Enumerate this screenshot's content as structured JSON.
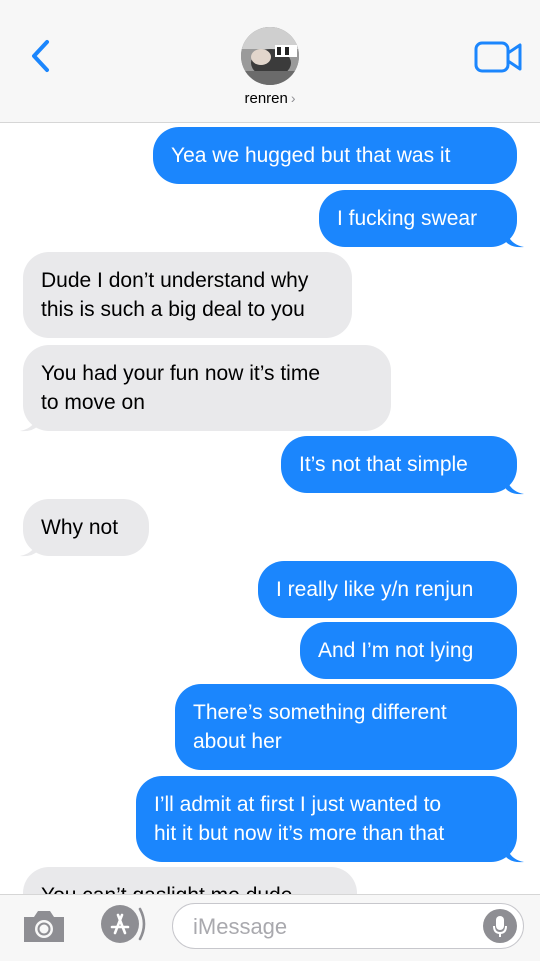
{
  "header": {
    "contact_name": "renren",
    "chevron": "›",
    "back_icon": "chevron-left-icon",
    "video_icon": "video-camera-icon",
    "accent_color": "#1b86fd"
  },
  "messages": [
    {
      "from": "me",
      "text": "Yea we hugged but that was it"
    },
    {
      "from": "me",
      "text": "I fucking swear"
    },
    {
      "from": "them",
      "text": "Dude I don’t understand why\nthis is such a big deal to you"
    },
    {
      "from": "them",
      "text": "You had your fun now it’s time\nto move on"
    },
    {
      "from": "me",
      "text": "It’s not that simple"
    },
    {
      "from": "them",
      "text": "Why not"
    },
    {
      "from": "me",
      "text": "I really like y/n renjun"
    },
    {
      "from": "me",
      "text": "And I’m not lying"
    },
    {
      "from": "me",
      "text": "There’s something different\nabout her"
    },
    {
      "from": "me",
      "text": "I’ll admit at first I just wanted to\nhit it but now it’s more than that"
    },
    {
      "from": "them",
      "text": "You can’t gaslight me dude"
    }
  ],
  "composer": {
    "placeholder": "iMessage",
    "camera_icon": "camera-icon",
    "apps_icon": "app-store-icon",
    "mic_icon": "microphone-icon"
  },
  "colors": {
    "outgoing_bubble": "#1b86fd",
    "incoming_bubble": "#e9e9eb"
  }
}
